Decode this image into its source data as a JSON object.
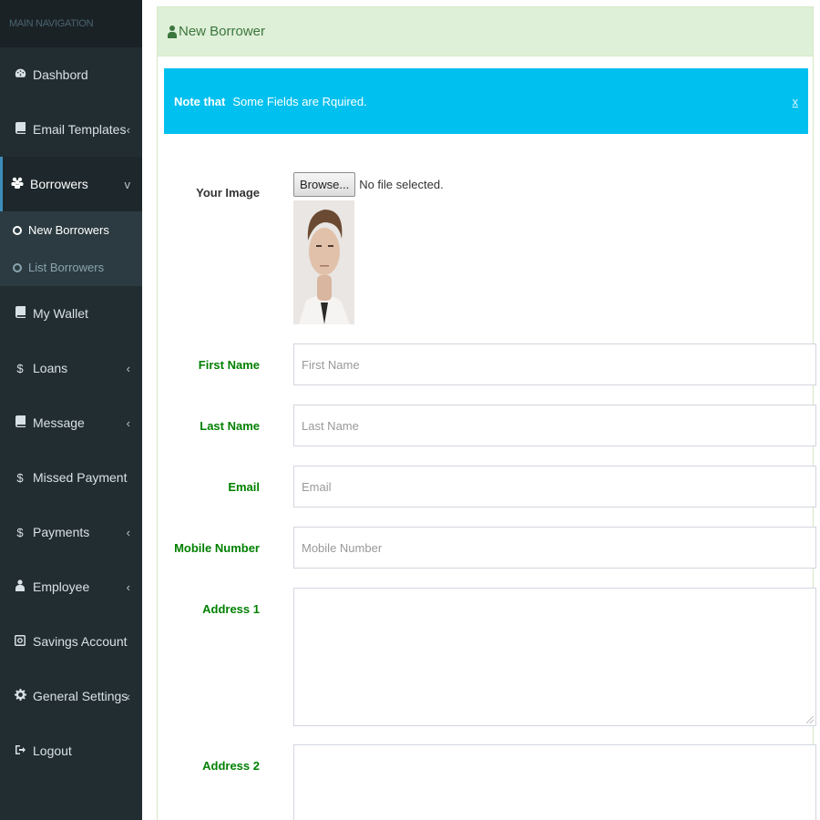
{
  "sidebar": {
    "header": "MAIN NAVIGATION",
    "items": [
      {
        "label": "Dashbord",
        "icon": "dashboard-icon",
        "has_chevron": false
      },
      {
        "label": "Email Templates",
        "icon": "book-icon",
        "has_chevron": true,
        "chevron": "‹"
      },
      {
        "label": "Borrowers",
        "icon": "users-icon",
        "has_chevron": true,
        "chevron": "v"
      },
      {
        "label": "My Wallet",
        "icon": "book-icon",
        "has_chevron": false
      },
      {
        "label": "Loans",
        "icon": "dollar-icon",
        "has_chevron": true,
        "chevron": "‹"
      },
      {
        "label": "Message",
        "icon": "book-icon",
        "has_chevron": true,
        "chevron": "‹"
      },
      {
        "label": "Missed Payment",
        "icon": "dollar-icon",
        "has_chevron": false
      },
      {
        "label": "Payments",
        "icon": "dollar-icon",
        "has_chevron": true,
        "chevron": "‹"
      },
      {
        "label": "Employee",
        "icon": "user-icon",
        "has_chevron": true,
        "chevron": "‹"
      },
      {
        "label": "Savings Account",
        "icon": "safe-icon",
        "has_chevron": false
      },
      {
        "label": "General Settings",
        "icon": "gear-icon",
        "has_chevron": true,
        "chevron": "‹"
      },
      {
        "label": "Logout",
        "icon": "logout-icon",
        "has_chevron": false
      }
    ],
    "submenu": [
      {
        "label": "New Borrowers"
      },
      {
        "label": "List Borrowers"
      }
    ]
  },
  "panel": {
    "title": "New Borrower"
  },
  "alert": {
    "strong": "Note that",
    "message": "Some Fields are Rquired.",
    "close": "x"
  },
  "form": {
    "image_label": "Your Image",
    "browse_label": "Browse...",
    "no_file": "No file selected.",
    "first_name_label": "First Name",
    "first_name_placeholder": "First Name",
    "last_name_label": "Last Name",
    "last_name_placeholder": "Last Name",
    "email_label": "Email",
    "email_placeholder": "Email",
    "mobile_label": "Mobile Number",
    "mobile_placeholder": "Mobile Number",
    "address1_label": "Address 1",
    "address2_label": "Address 2"
  },
  "colors": {
    "sidebar_bg": "#222d32",
    "active_border": "#3c8dbc",
    "header_bg": "#dff0d8",
    "alert_bg": "#00c0ef",
    "label_green": "#008000"
  }
}
